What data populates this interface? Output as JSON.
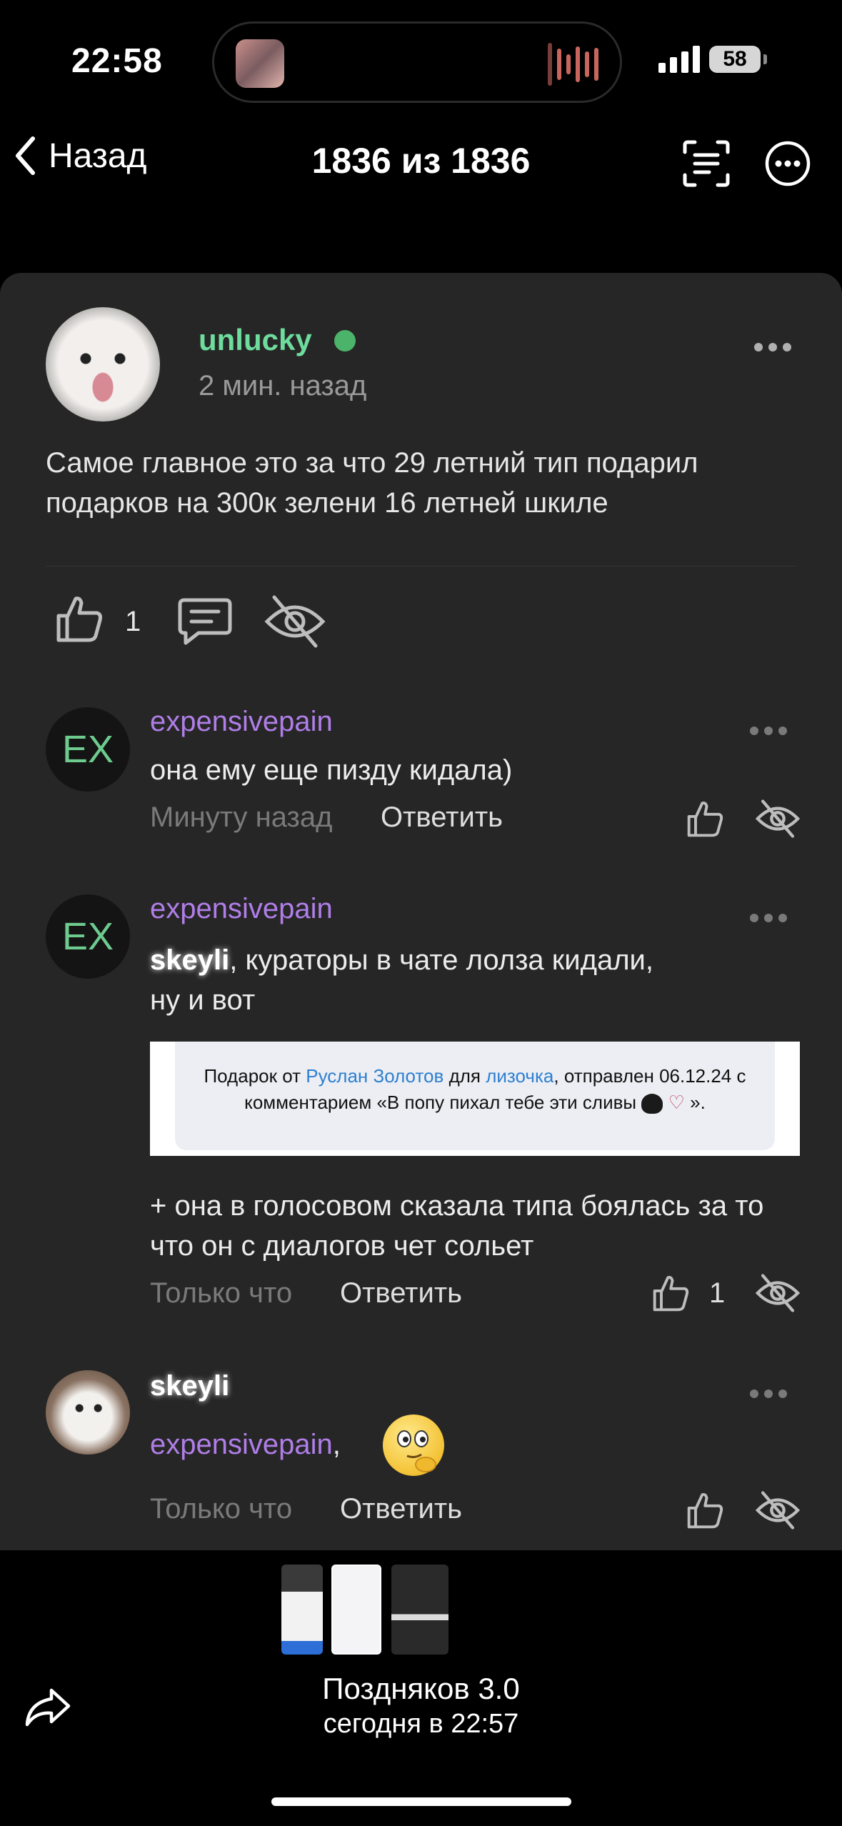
{
  "status": {
    "time": "22:58",
    "battery": "58"
  },
  "nav": {
    "back_label": "Назад",
    "title": "1836 из 1836"
  },
  "post": {
    "author": "unlucky",
    "time": "2 мин. назад",
    "text": "Самое главное это за что 29 летний тип подарил подарков на 300к зелени 16 летней шкиле",
    "likes": "1"
  },
  "comments": [
    {
      "avatar": "EX",
      "author": "expensivepain",
      "text": "она ему еще пизду кидала)",
      "time": "Минуту назад",
      "reply": "Ответить"
    },
    {
      "avatar": "EX",
      "author": "expensivepain",
      "mention": "skeyli",
      "text_after_mention": ", кураторы в чате лолза кидали,",
      "text_line2": "ну и вот",
      "quote": {
        "prefix": "Подарок от ",
        "from": "Руслан Золотов",
        "middle": " для ",
        "to": "лизочка",
        "suffix": ", отправлен 06.12.24 с комментарием «В попу пихал тебе эти сливы",
        "end": "»."
      },
      "text2": "+ она в голосовом сказала типа боялась за то что он с диалогов чет сольет",
      "time": "Только что",
      "reply": "Ответить",
      "likes": "1"
    },
    {
      "author": "skeyli",
      "mention": "expensivepain",
      "mention_suffix": ",",
      "time": "Только что",
      "reply": "Ответить"
    }
  ],
  "bottom": {
    "title": "Поздняков 3.0",
    "subtitle": "сегодня в 22:57"
  },
  "colors": {
    "author_green": "#6ddc9c",
    "author_purple": "#b07ee8",
    "card": "#262626"
  }
}
